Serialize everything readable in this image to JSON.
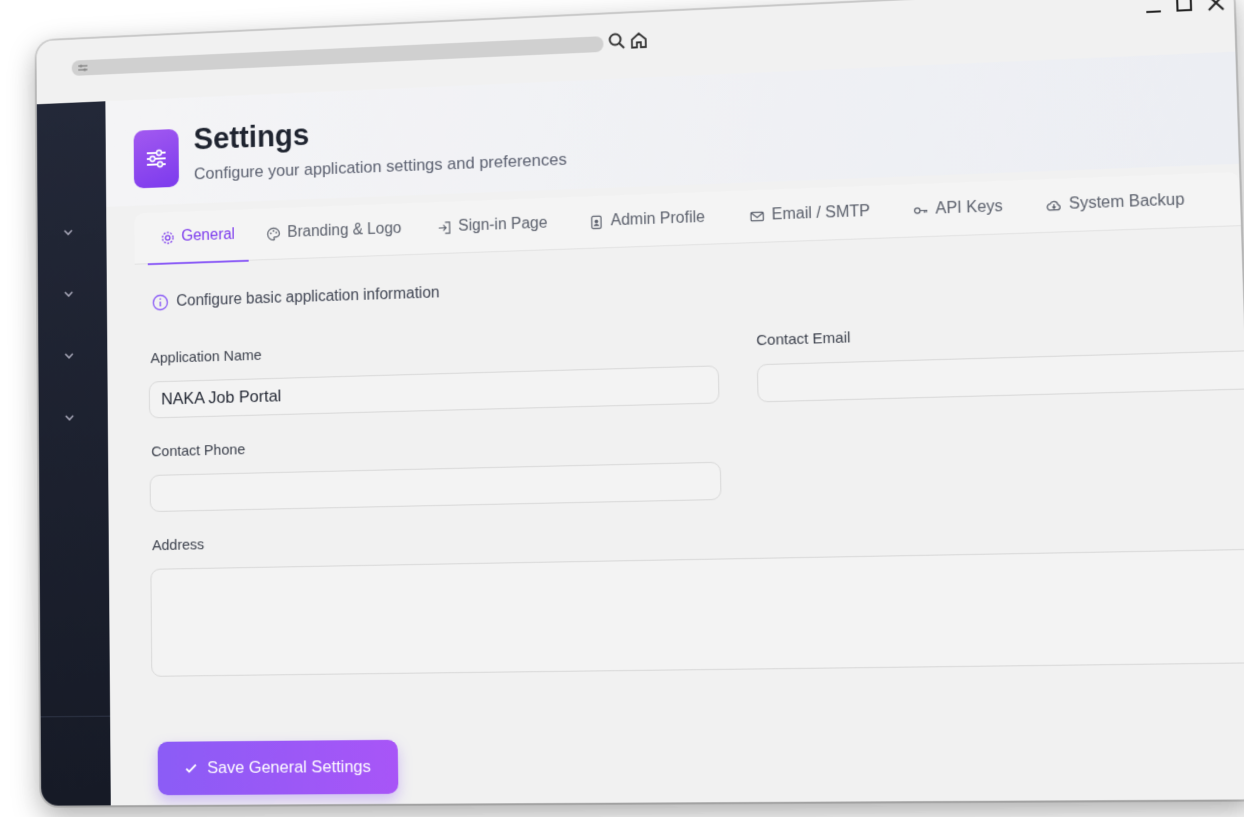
{
  "header": {
    "title": "Settings",
    "subtitle": "Configure your application settings and preferences"
  },
  "tabs": [
    {
      "label": "General",
      "icon": "gear-icon",
      "active": true
    },
    {
      "label": "Branding & Logo",
      "icon": "palette-icon",
      "active": false
    },
    {
      "label": "Sign-in Page",
      "icon": "sign-in-icon",
      "active": false
    },
    {
      "label": "Admin Profile",
      "icon": "id-badge-icon",
      "active": false
    },
    {
      "label": "Email / SMTP",
      "icon": "envelope-icon",
      "active": false
    },
    {
      "label": "API Keys",
      "icon": "key-icon",
      "active": false
    },
    {
      "label": "System Backup",
      "icon": "cloud-download-icon",
      "active": false
    }
  ],
  "general": {
    "info_text": "Configure basic application information",
    "app_name_label": "Application Name",
    "app_name_value": "NAKA Job Portal",
    "contact_email_label": "Contact Email",
    "contact_email_value": "",
    "contact_phone_label": "Contact Phone",
    "contact_phone_value": "",
    "address_label": "Address",
    "address_value": "",
    "save_label": "Save General Settings"
  },
  "colors": {
    "accent": "#8b5cf6",
    "sidebar": "#1c2130"
  }
}
